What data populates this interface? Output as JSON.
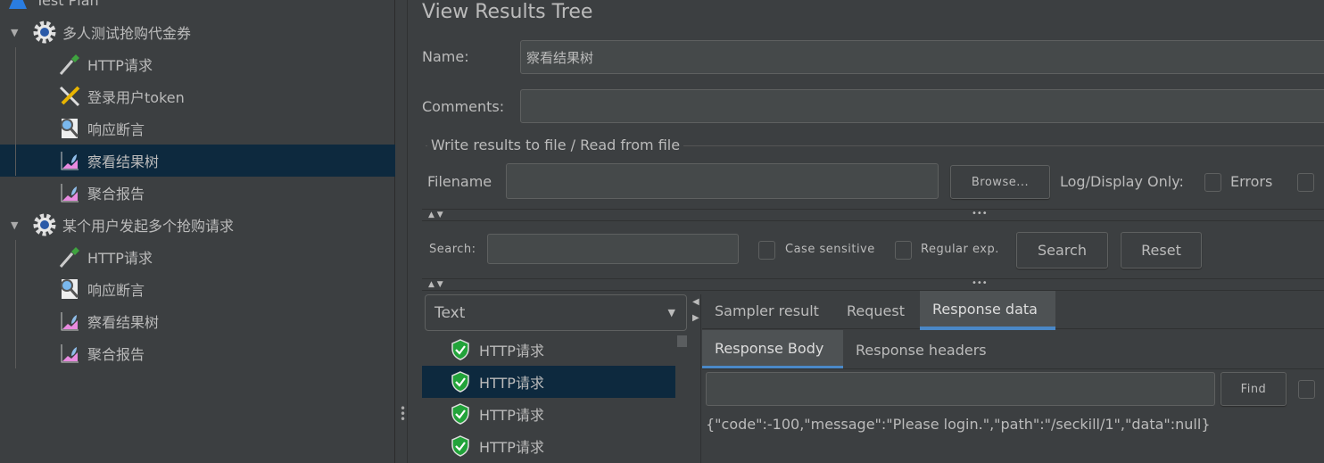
{
  "tree": {
    "items": [
      {
        "label": "Test Plan",
        "icon": "test-plan-icon",
        "level": 0
      },
      {
        "label": "多人测试抢购代金券",
        "icon": "thread-group-gear-icon",
        "level": 0,
        "expanded": true
      },
      {
        "label": "HTTP请求",
        "icon": "sampler-dropper-icon",
        "level": 1
      },
      {
        "label": "登录用户token",
        "icon": "config-tools-icon",
        "level": 1
      },
      {
        "label": "响应断言",
        "icon": "assertion-magnifier-icon",
        "level": 1
      },
      {
        "label": "察看结果树",
        "icon": "listener-chart-icon",
        "level": 1,
        "selected": true
      },
      {
        "label": "聚合报告",
        "icon": "listener-chart-icon",
        "level": 1
      },
      {
        "label": "某个用户发起多个抢购请求",
        "icon": "thread-group-gear-icon",
        "level": 0,
        "expanded": true
      },
      {
        "label": "HTTP请求",
        "icon": "sampler-dropper-icon",
        "level": 1
      },
      {
        "label": "响应断言",
        "icon": "assertion-magnifier-icon",
        "level": 1
      },
      {
        "label": "察看结果树",
        "icon": "listener-chart-icon",
        "level": 1
      },
      {
        "label": "聚合报告",
        "icon": "listener-chart-icon",
        "level": 1
      }
    ]
  },
  "panel": {
    "title": "View Results Tree",
    "name_label": "Name:",
    "name_value": "察看结果树",
    "comments_label": "Comments:",
    "comments_value": "",
    "file_group": "Write results to file / Read from file",
    "filename_label": "Filename",
    "filename_value": "",
    "browse": "Browse...",
    "log_display": "Log/Display Only:",
    "errors": "Errors",
    "search_label": "Search:",
    "search_value": "",
    "case_sensitive": "Case sensitive",
    "regular_exp": "Regular exp.",
    "search_btn": "Search",
    "reset_btn": "Reset",
    "renderer": "Text",
    "results": [
      {
        "label": "HTTP请求",
        "status": "success"
      },
      {
        "label": "HTTP请求",
        "status": "success",
        "selected": true
      },
      {
        "label": "HTTP请求",
        "status": "success"
      },
      {
        "label": "HTTP请求",
        "status": "success"
      }
    ],
    "tabs": [
      "Sampler result",
      "Request",
      "Response data"
    ],
    "active_tab": "Response data",
    "subtabs": [
      "Response Body",
      "Response headers"
    ],
    "active_subtab": "Response Body",
    "find_value": "",
    "find_btn": "Find",
    "response_body": "{\"code\":-100,\"message\":\"Please login.\",\"path\":\"/seckill/1\",\"data\":null}"
  },
  "colors": {
    "background": "#3c3f41",
    "selection": "#0d293e",
    "accent": "#4a88c7",
    "success": "#22a33a"
  }
}
